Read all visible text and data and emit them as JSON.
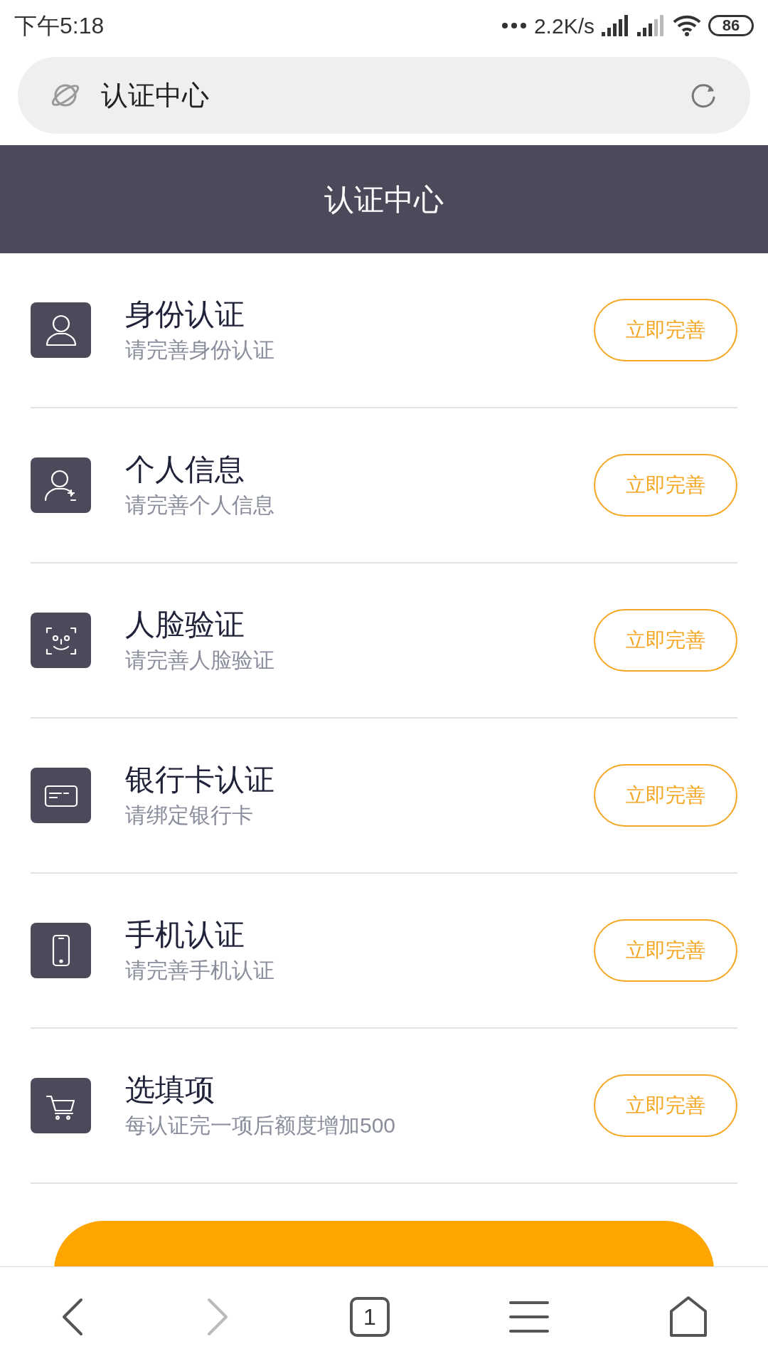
{
  "status_bar": {
    "time": "下午5:18",
    "speed": "2.2K/s",
    "battery": "86"
  },
  "address_bar": {
    "title": "认证中心"
  },
  "header": {
    "title": "认证中心"
  },
  "items": [
    {
      "kind": "id",
      "title": "身份认证",
      "subtitle": "请完善身份认证",
      "action": "立即完善"
    },
    {
      "kind": "person",
      "title": "个人信息",
      "subtitle": "请完善个人信息",
      "action": "立即完善"
    },
    {
      "kind": "face",
      "title": "人脸验证",
      "subtitle": "请完善人脸验证",
      "action": "立即完善"
    },
    {
      "kind": "card",
      "title": "银行卡认证",
      "subtitle": "请绑定银行卡",
      "action": "立即完善"
    },
    {
      "kind": "phone",
      "title": "手机认证",
      "subtitle": "请完善手机认证",
      "action": "立即完善"
    },
    {
      "kind": "cart",
      "title": "选填项",
      "subtitle": "每认证完一项后额度增加500",
      "action": "立即完善"
    }
  ],
  "bottom_nav": {
    "tab_count": "1"
  }
}
